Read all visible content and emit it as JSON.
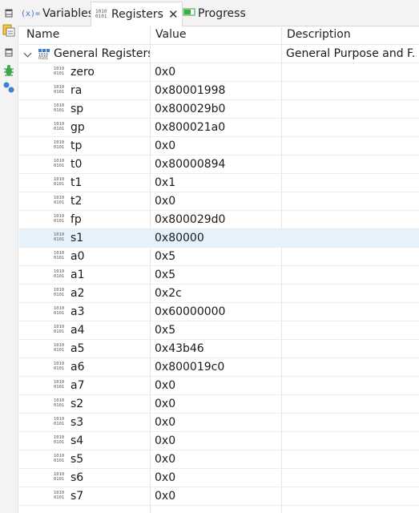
{
  "tabs": [
    {
      "icon": "variables-icon",
      "icon_text": "(x)=",
      "label": "Variables"
    },
    {
      "icon": "registers-icon",
      "label": "Registers",
      "close": "✕"
    },
    {
      "icon": "progress-icon",
      "label": "Progress"
    }
  ],
  "table": {
    "columns": [
      "Name",
      "Value",
      "Description"
    ],
    "group": {
      "name": "General Registers",
      "description": "General Purpose and F..."
    },
    "rows": [
      {
        "name": "zero",
        "value": "0x0"
      },
      {
        "name": "ra",
        "value": "0x80001998"
      },
      {
        "name": "sp",
        "value": "0x800029b0"
      },
      {
        "name": "gp",
        "value": "0x800021a0"
      },
      {
        "name": "tp",
        "value": "0x0"
      },
      {
        "name": "t0",
        "value": "0x80000894"
      },
      {
        "name": "t1",
        "value": "0x1"
      },
      {
        "name": "t2",
        "value": "0x0"
      },
      {
        "name": "fp",
        "value": "0x800029d0"
      },
      {
        "name": "s1",
        "value": "0x80000",
        "selected": true
      },
      {
        "name": "a0",
        "value": "0x5"
      },
      {
        "name": "a1",
        "value": "0x5"
      },
      {
        "name": "a2",
        "value": "0x2c"
      },
      {
        "name": "a3",
        "value": "0x60000000"
      },
      {
        "name": "a4",
        "value": "0x5"
      },
      {
        "name": "a5",
        "value": "0x43b46"
      },
      {
        "name": "a6",
        "value": "0x800019c0"
      },
      {
        "name": "a7",
        "value": "0x0"
      },
      {
        "name": "s2",
        "value": "0x0"
      },
      {
        "name": "s3",
        "value": "0x0"
      },
      {
        "name": "s4",
        "value": "0x0"
      },
      {
        "name": "s5",
        "value": "0x0"
      },
      {
        "name": "s6",
        "value": "0x0"
      },
      {
        "name": "s7",
        "value": "0x0"
      }
    ]
  },
  "colors": {
    "selected_row": "#e5f1fb",
    "accent": "#1f6fd1"
  }
}
